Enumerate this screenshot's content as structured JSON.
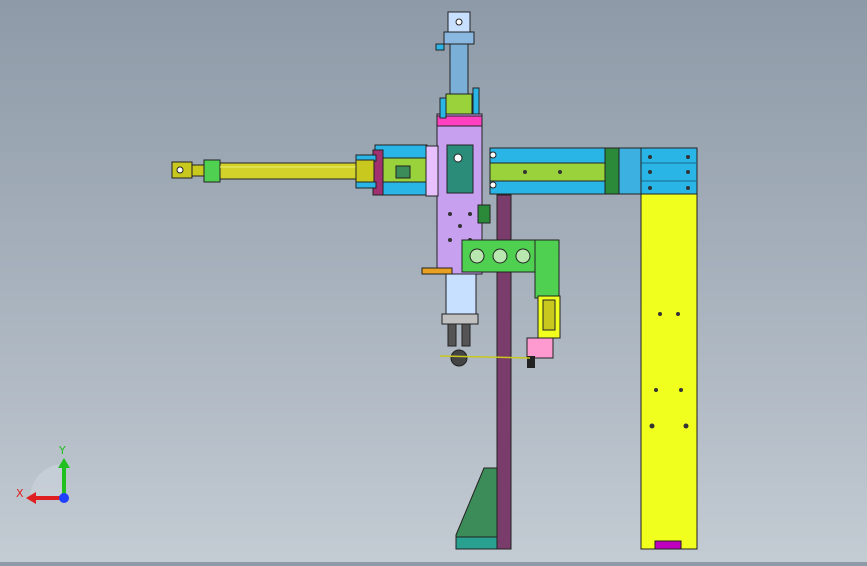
{
  "viewport": {
    "background_top": "#8e9aa8",
    "background_bottom": "#c3cbd3"
  },
  "axis_triad": {
    "x_label": "X",
    "y_label": "Y",
    "x_color": "#e02020",
    "y_color": "#20c020",
    "z_color": "#2040ff"
  },
  "model": {
    "icon": "cad-assembly-icon",
    "colors": {
      "beam": "#29b6e6",
      "column": "#f0ff1e",
      "cylinder": "#c8c81e",
      "carriage": "#c8a0f0",
      "bracket": "#50d050",
      "post": "#7a3c6a",
      "base": "#3c8c5a",
      "accent": "#ff40c0"
    }
  }
}
